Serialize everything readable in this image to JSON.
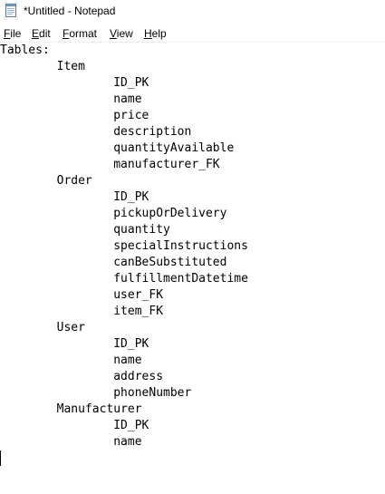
{
  "window": {
    "title": "*Untitled - Notepad",
    "app_icon": "notepad-icon"
  },
  "menu": {
    "items": [
      {
        "mnemonic": "F",
        "rest": "ile"
      },
      {
        "mnemonic": "E",
        "rest": "dit"
      },
      {
        "mnemonic": "F",
        "rest": "ormat"
      },
      {
        "mnemonic": "V",
        "rest": "iew"
      },
      {
        "mnemonic": "H",
        "rest": "elp"
      }
    ]
  },
  "document": {
    "lines": [
      "Tables:",
      "\tItem",
      "\t\tID_PK",
      "\t\tname",
      "\t\tprice",
      "\t\tdescription",
      "\t\tquantityAvailable",
      "\t\tmanufacturer_FK",
      "\tOrder",
      "\t\tID_PK",
      "\t\tpickupOrDelivery",
      "\t\tquantity",
      "\t\tspecialInstructions",
      "\t\tcanBeSubstituted",
      "\t\tfulfillmentDatetime",
      "\t\tuser_FK",
      "\t\titem_FK",
      "\tUser",
      "\t\tID_PK",
      "\t\tname",
      "\t\taddress",
      "\t\tphoneNumber",
      "\tManufacturer",
      "\t\tID_PK",
      "\t\tname",
      ""
    ]
  }
}
